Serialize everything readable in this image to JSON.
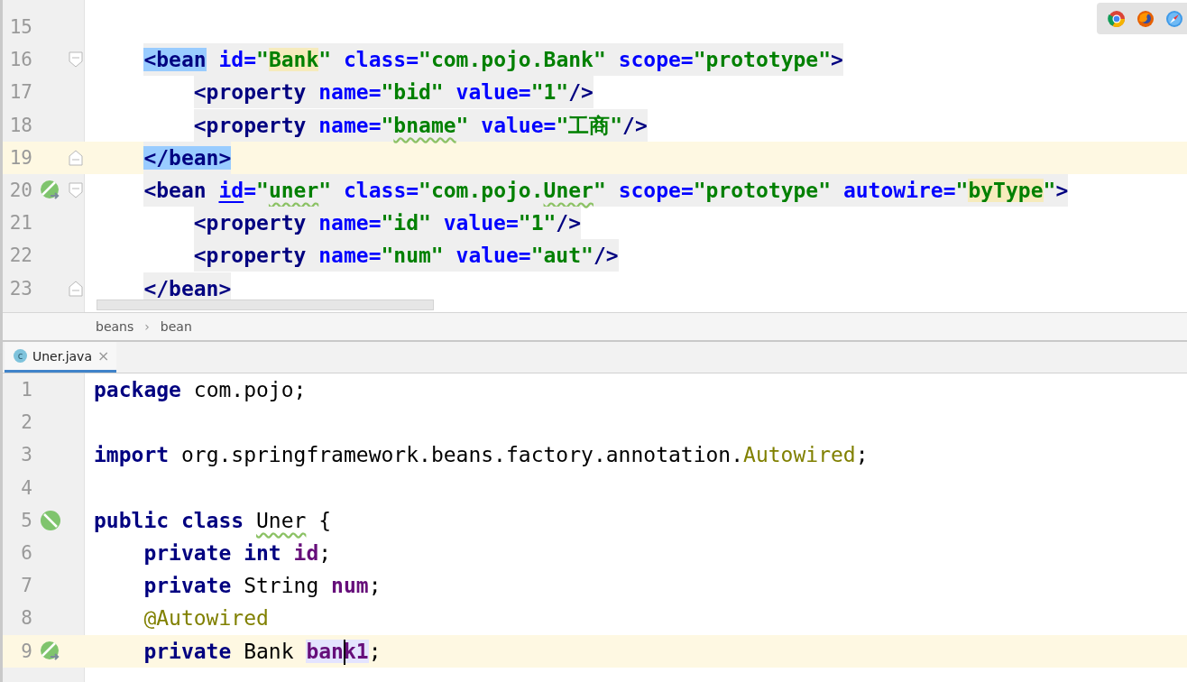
{
  "xml_editor": {
    "lines": [
      {
        "number": "15",
        "current": false
      },
      {
        "number": "16",
        "current": false,
        "fold": {
          "kind": "start"
        },
        "tokens": [
          {
            "t": "<bean",
            "kind": "tag",
            "matched": true
          },
          {
            "t": " id=",
            "kind": "attr"
          },
          {
            "t": "\"",
            "kind": "str"
          },
          {
            "t": "Bank",
            "kind": "str",
            "usage": true
          },
          {
            "t": "\"",
            "kind": "str"
          },
          {
            "t": " class=",
            "kind": "attr"
          },
          {
            "t": "\"com.pojo.Bank\"",
            "kind": "str"
          },
          {
            "t": " scope=",
            "kind": "attr"
          },
          {
            "t": "\"prototype\"",
            "kind": "str"
          },
          {
            "t": ">",
            "kind": "tag"
          }
        ],
        "children": [
          {
            "number": "17",
            "current": false,
            "tokens": [
              {
                "t": "<property",
                "kind": "tag"
              },
              {
                "t": " name=",
                "kind": "attr"
              },
              {
                "t": "\"bid\"",
                "kind": "str"
              },
              {
                "t": " value=",
                "kind": "attr"
              },
              {
                "t": "\"1\"",
                "kind": "str"
              },
              {
                "t": "/>",
                "kind": "tag"
              }
            ]
          },
          {
            "number": "18",
            "current": false,
            "tokens": [
              {
                "t": "<property",
                "kind": "tag"
              },
              {
                "t": " name=",
                "kind": "attr"
              },
              {
                "t": "\"",
                "kind": "str"
              },
              {
                "t": "bname",
                "kind": "str",
                "squiggle": true
              },
              {
                "t": "\"",
                "kind": "str"
              },
              {
                "t": " value=",
                "kind": "attr"
              },
              {
                "t": "\"工商\"",
                "kind": "str"
              },
              {
                "t": "/>",
                "kind": "tag"
              }
            ]
          }
        ]
      },
      {
        "number": "19",
        "current": true,
        "fold": {
          "kind": "end"
        },
        "tokens": [
          {
            "t": "</bean>",
            "kind": "tag",
            "matched": true
          }
        ]
      },
      {
        "number": "20",
        "current": false,
        "gutter_icon": {
          "kind": "bean-link"
        },
        "fold": {
          "kind": "start"
        },
        "tokens": [
          {
            "t": "<bean ",
            "kind": "tag"
          },
          {
            "t": "id",
            "kind": "attr",
            "underlined": true
          },
          {
            "t": "=",
            "kind": "attr"
          },
          {
            "t": "\"",
            "kind": "str"
          },
          {
            "t": "uner",
            "kind": "str",
            "squiggle": true
          },
          {
            "t": "\"",
            "kind": "str"
          },
          {
            "t": " class=",
            "kind": "attr"
          },
          {
            "t": "\"com.pojo.",
            "kind": "str"
          },
          {
            "t": "Uner",
            "kind": "str",
            "squiggle": true
          },
          {
            "t": "\"",
            "kind": "str"
          },
          {
            "t": " scope=",
            "kind": "attr"
          },
          {
            "t": "\"prototype\"",
            "kind": "str"
          },
          {
            "t": " autowire=",
            "kind": "attr"
          },
          {
            "t": "\"",
            "kind": "str"
          },
          {
            "t": "byType",
            "kind": "str",
            "usage": true
          },
          {
            "t": "\"",
            "kind": "str"
          },
          {
            "t": ">",
            "kind": "tag"
          }
        ],
        "children": [
          {
            "number": "21",
            "current": false,
            "tokens": [
              {
                "t": "<property",
                "kind": "tag"
              },
              {
                "t": " name=",
                "kind": "attr"
              },
              {
                "t": "\"id\"",
                "kind": "str"
              },
              {
                "t": " value=",
                "kind": "attr"
              },
              {
                "t": "\"1\"",
                "kind": "str"
              },
              {
                "t": "/>",
                "kind": "tag"
              }
            ]
          },
          {
            "number": "22",
            "current": false,
            "tokens": [
              {
                "t": "<property",
                "kind": "tag"
              },
              {
                "t": " name=",
                "kind": "attr"
              },
              {
                "t": "\"num\"",
                "kind": "str"
              },
              {
                "t": " value=",
                "kind": "attr"
              },
              {
                "t": "\"aut\"",
                "kind": "str"
              },
              {
                "t": "/>",
                "kind": "tag"
              }
            ]
          }
        ]
      },
      {
        "number": "23",
        "current": false,
        "fold": {
          "kind": "end"
        },
        "tokens": [
          {
            "t": "</bean>",
            "kind": "tag"
          }
        ]
      }
    ]
  },
  "breadcrumbs": [
    {
      "label": "beans"
    },
    {
      "label": "bean"
    }
  ],
  "breadcrumb_separator": "›",
  "tabs": [
    {
      "label": "Uner.java",
      "icon_letter": "c",
      "close": "×",
      "selected": true
    }
  ],
  "java_editor": {
    "lines": [
      {
        "number": "1",
        "current": false,
        "tokens": [
          {
            "t": "package",
            "kind": "kw"
          },
          {
            "t": " com.pojo;",
            "kind": "plain"
          }
        ]
      },
      {
        "number": "2",
        "current": false
      },
      {
        "number": "3",
        "current": false,
        "tokens": [
          {
            "t": "import",
            "kind": "kw"
          },
          {
            "t": " org.springframework.beans.factory.annotation.",
            "kind": "plain"
          },
          {
            "t": "Autowired",
            "kind": "ann"
          },
          {
            "t": ";",
            "kind": "plain"
          }
        ]
      },
      {
        "number": "4",
        "current": false
      },
      {
        "number": "5",
        "current": false,
        "gutter_icon": {
          "kind": "bean-class"
        },
        "tokens": [
          {
            "t": "public class ",
            "kind": "kw"
          },
          {
            "t": "Uner",
            "kind": "plain",
            "squiggle": true
          },
          {
            "t": " {",
            "kind": "plain"
          }
        ],
        "children": [
          {
            "number": "6",
            "current": false,
            "tokens": [
              {
                "t": "private int ",
                "kind": "kw"
              },
              {
                "t": "id",
                "kind": "field"
              },
              {
                "t": ";",
                "kind": "plain"
              }
            ]
          },
          {
            "number": "7",
            "current": false,
            "tokens": [
              {
                "t": "private",
                "kind": "kw"
              },
              {
                "t": " String ",
                "kind": "plain"
              },
              {
                "t": "num",
                "kind": "field"
              },
              {
                "t": ";",
                "kind": "plain"
              }
            ]
          },
          {
            "number": "8",
            "current": false,
            "tokens": [
              {
                "t": "@Autowired",
                "kind": "ann"
              }
            ]
          },
          {
            "number": "9",
            "current": true,
            "gutter_icon": {
              "kind": "bean-link"
            },
            "tokens": [
              {
                "t": "private",
                "kind": "kw"
              },
              {
                "t": " Bank ",
                "kind": "plain"
              },
              {
                "t": "ban",
                "kind": "field",
                "identifier": true,
                "caret": true
              },
              {
                "t": "k1",
                "kind": "field",
                "identifier": true
              },
              {
                "t": ";",
                "kind": "plain"
              }
            ]
          }
        ]
      }
    ]
  }
}
